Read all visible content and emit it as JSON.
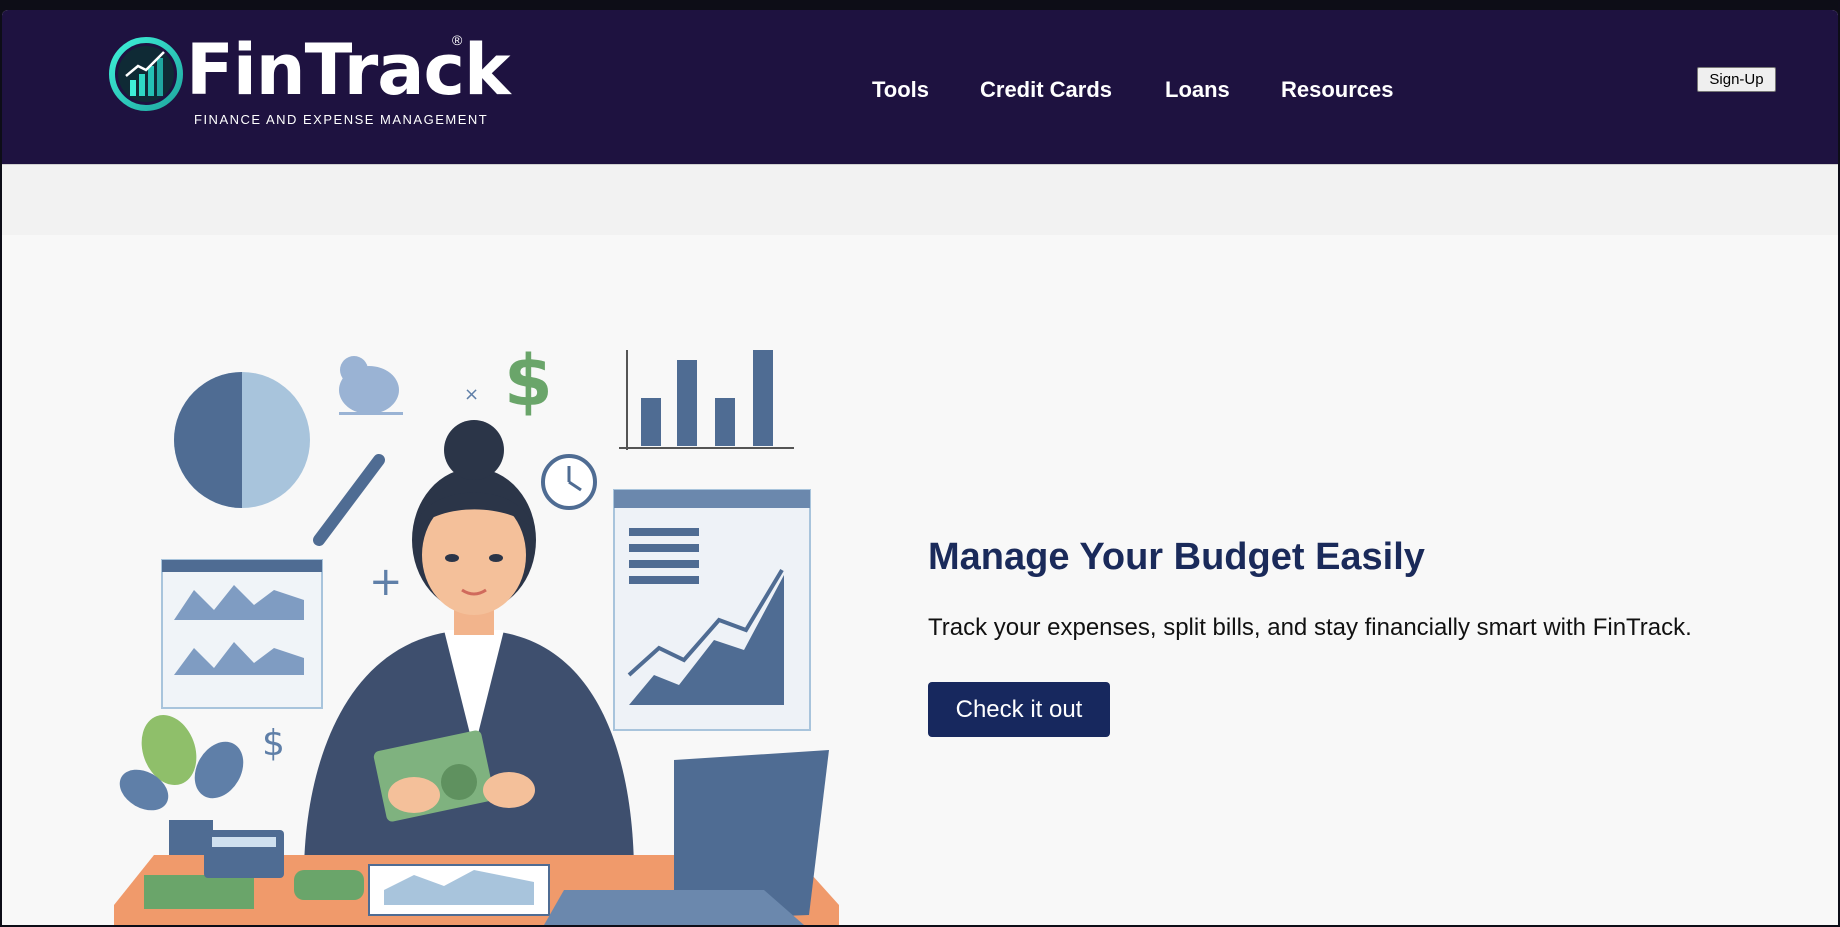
{
  "brand": {
    "name": "FinTrack",
    "trademark": "®",
    "tagline": "FINANCE AND EXPENSE MANAGEMENT",
    "colors": {
      "primary": "#1e1240",
      "accent": "#17285e",
      "teal": "#27d3c3"
    }
  },
  "nav": {
    "items": [
      {
        "label": "Tools"
      },
      {
        "label": "Credit Cards"
      },
      {
        "label": "Loans"
      },
      {
        "label": "Resources"
      }
    ],
    "signup_label": "Sign-Up"
  },
  "hero": {
    "title": "Manage Your Budget Easily",
    "subtitle": "Track your expenses, split bills, and stay financially smart with FinTrack.",
    "cta_label": "Check it out",
    "illustration": "woman-counting-money-with-finance-charts",
    "illustration_dollar_sign": "$"
  }
}
